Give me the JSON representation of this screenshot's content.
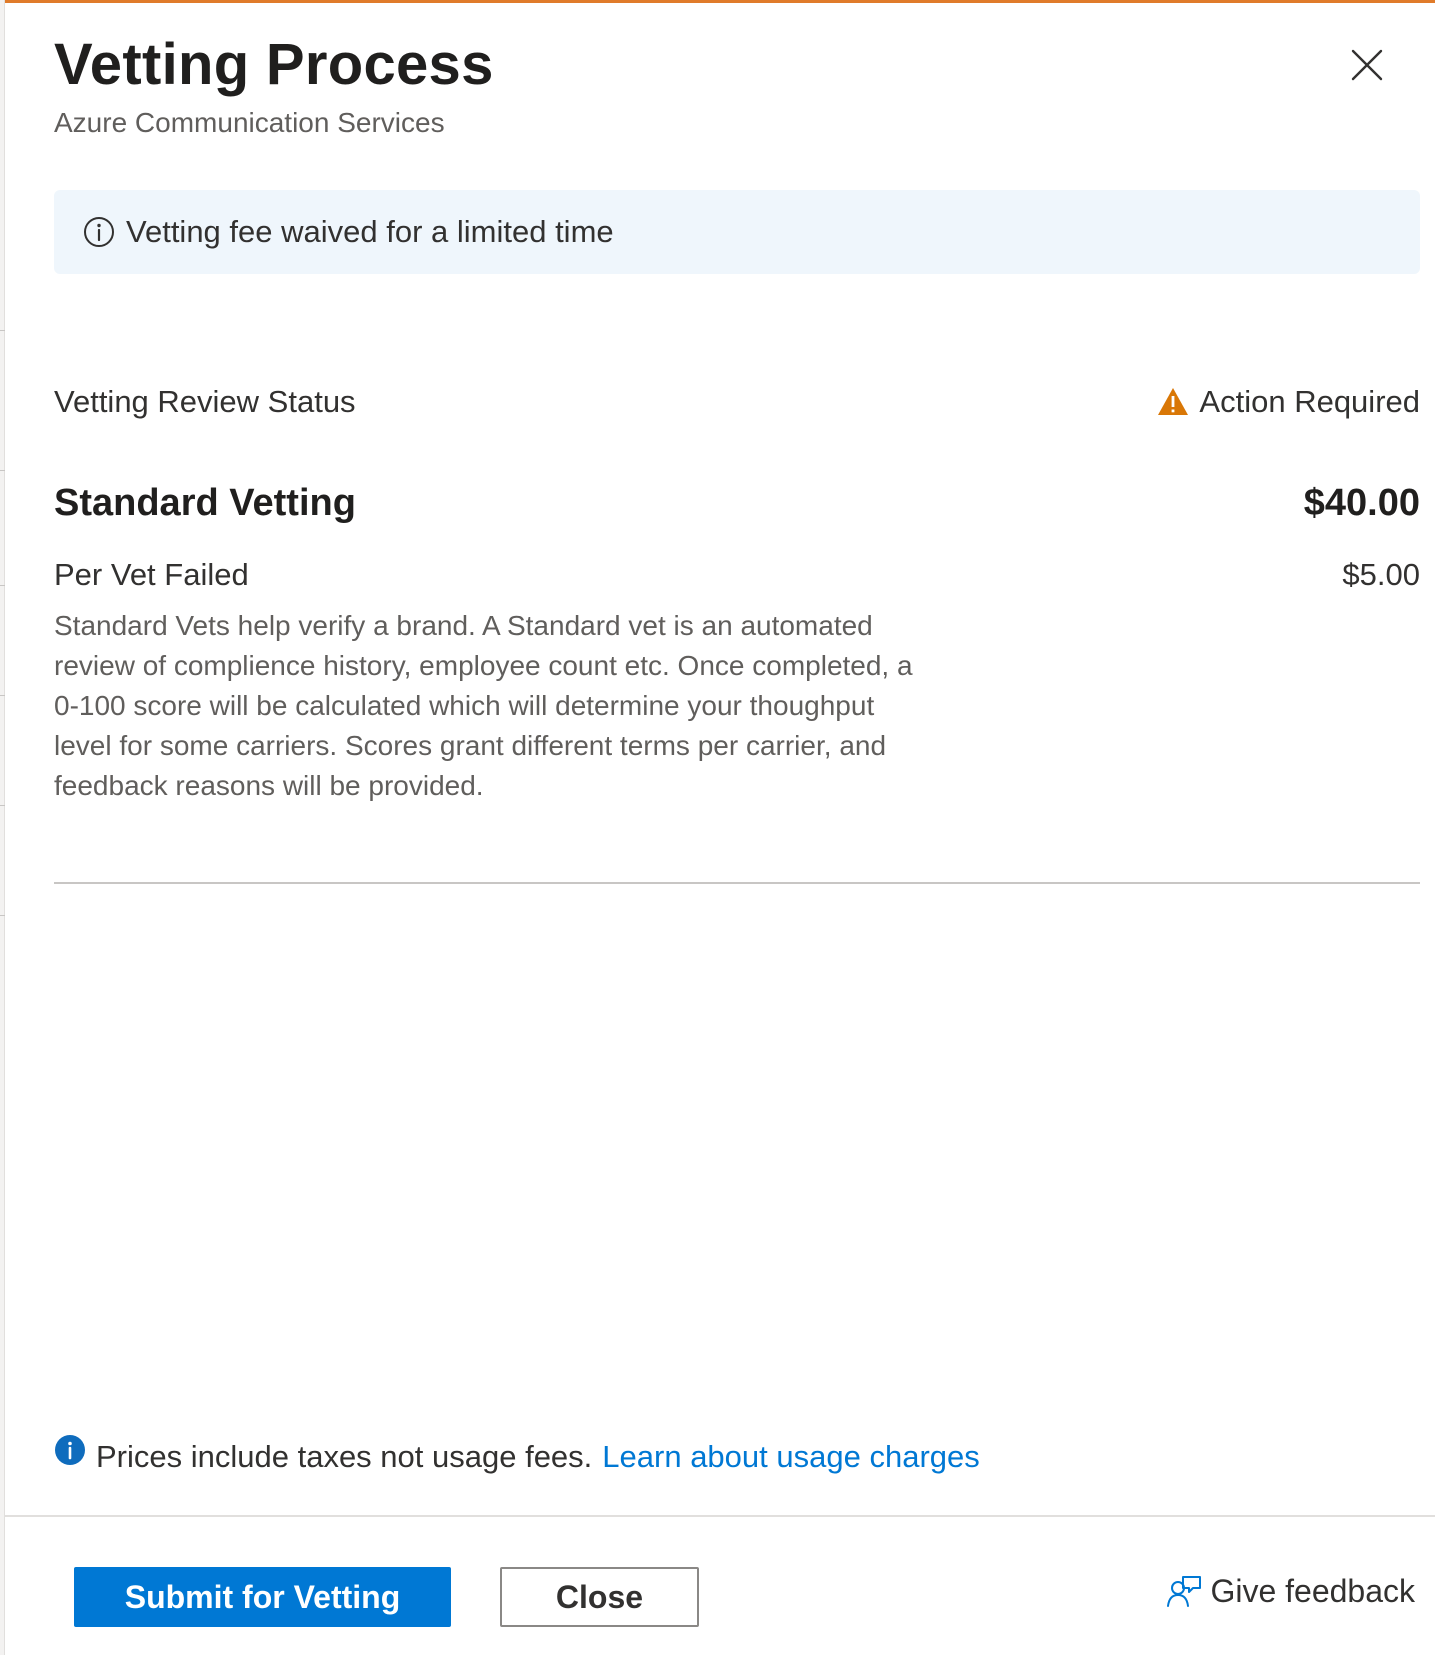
{
  "panel": {
    "title": "Vetting Process",
    "subtitle": "Azure Communication Services",
    "close_icon": "close-icon",
    "accent_color": "#e07b2a"
  },
  "banner": {
    "icon": "info-outline-icon",
    "text": "Vetting fee waived for a limited time",
    "background": "#eff6fc"
  },
  "status": {
    "label": "Vetting Review Status",
    "icon": "warning-icon",
    "icon_color": "#d97706",
    "value": "Action Required"
  },
  "standard_vetting": {
    "name": "Standard Vetting",
    "price": "$40.00",
    "fail_label": "Per Vet Failed",
    "fail_price": "$5.00",
    "description": "Standard Vets help verify a brand. A Standard vet is an automated review of complience history, employee count etc. Once completed, a 0-100 score will be calculated which will determine your thoughput level for some carriers. Scores grant different terms per carrier, and feedback reasons will be provided."
  },
  "note": {
    "icon": "info-filled-icon",
    "text": "Prices include taxes not usage fees.",
    "link_text": "Learn about usage charges",
    "link_color": "#0078d4"
  },
  "footer": {
    "primary_label": "Submit for Vetting",
    "primary_color": "#0078d4",
    "secondary_label": "Close",
    "feedback_icon": "feedback-person-icon",
    "feedback_label": "Give feedback"
  }
}
